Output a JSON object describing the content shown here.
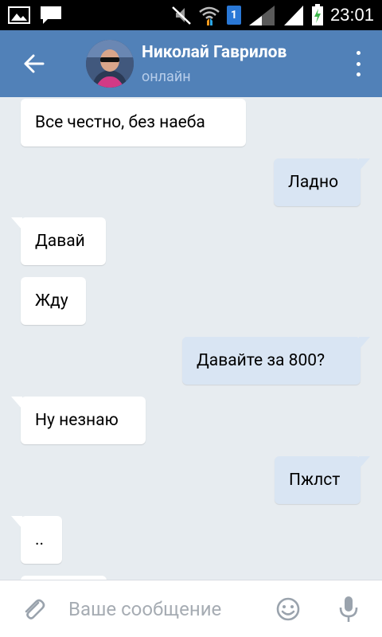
{
  "status_bar": {
    "time": "23:01",
    "sim_label": "1",
    "icons": [
      "image-icon",
      "chat-icon",
      "mute-icon",
      "wifi-icon",
      "sim-icon",
      "signal-icon",
      "signal-icon",
      "battery-charging-icon"
    ]
  },
  "header": {
    "name": "Николай Гаврилов",
    "status": "онлайн",
    "bg_color": "#5181b8"
  },
  "messages": [
    {
      "direction": "in",
      "text": "Все честно, без наеба"
    },
    {
      "direction": "out",
      "text": "Ладно"
    },
    {
      "direction": "in",
      "text": "Давай"
    },
    {
      "direction": "in",
      "text": "Жду"
    },
    {
      "direction": "out",
      "text": "Давайте за 800?"
    },
    {
      "direction": "in",
      "text": "Ну незнаю"
    },
    {
      "direction": "out",
      "text": "Пжлст"
    },
    {
      "direction": "in",
      "text": ".."
    }
  ],
  "composer": {
    "placeholder": "Ваше сообщение",
    "icons": [
      "paperclip-icon",
      "smile-icon",
      "microphone-icon"
    ]
  },
  "colors": {
    "accent": "#5181b8",
    "incoming_bubble": "#ffffff",
    "outgoing_bubble": "#d9e5f3",
    "background": "#e7ecf0"
  }
}
